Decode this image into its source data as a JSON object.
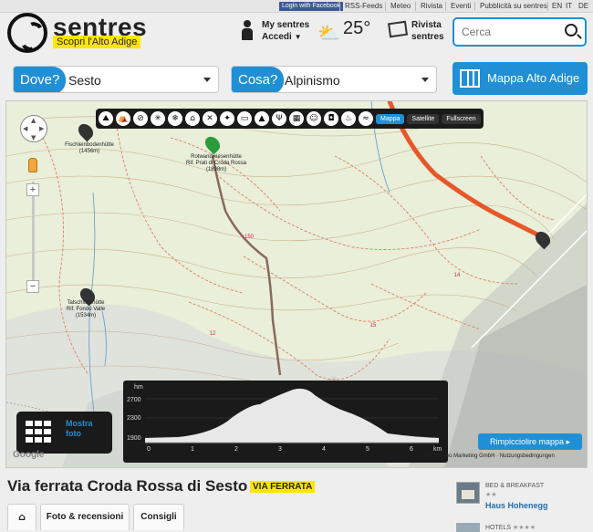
{
  "topbar": {
    "facebook_login": "Login with Facebook",
    "links": [
      "RSS-Feeds",
      "Meteo",
      "Rivista",
      "Eventi",
      "Pubblicità su sentres",
      "EN",
      "IT",
      "DE"
    ]
  },
  "brand": {
    "name": "sentres",
    "tagline": "Scopri l'Alto Adige"
  },
  "account": {
    "line1": "My sentres",
    "line2": "Accedi"
  },
  "weather": {
    "temperature": "25°"
  },
  "magazine": {
    "line1": "Rivista",
    "line2": "sentres"
  },
  "search": {
    "placeholder": "Cerca"
  },
  "filters": {
    "where": {
      "label": "Dove?",
      "value": "Sesto"
    },
    "what": {
      "label": "Cosa?",
      "value": "Alpinismo"
    }
  },
  "map_button": {
    "label": "Mappa Alto Adige"
  },
  "map": {
    "view_buttons": [
      "Mappa",
      "Satellite",
      "Fullscreen"
    ],
    "active_view": "Mappa",
    "category_icons": [
      "hiking-icon",
      "climbing-icon",
      "bike-icon",
      "ski-icon",
      "snow-icon",
      "hut-icon",
      "tool-icon",
      "food-icon",
      "bed-icon",
      "camping-icon",
      "fork-icon",
      "calendar-icon",
      "family-icon",
      "bag-icon",
      "spa-icon",
      "swim-icon"
    ],
    "huts": [
      {
        "name": "Fischleinbodenhütte",
        "elevation": "(1456m)"
      },
      {
        "name": "Rotwandwiesenhütte",
        "name2": "Rif. Prati di Croda Rossa",
        "elevation": "(1898m)"
      },
      {
        "name": "Talschlusshütte",
        "name2": "Rif. Fondo Valle",
        "elevation": "(1534m)"
      }
    ],
    "contour_labels": [
      "150",
      "15",
      "14",
      "12",
      "15",
      "14",
      "15",
      "14"
    ],
    "zoom_in": "+",
    "zoom_out": "−",
    "show_photos": "Mostra foto",
    "shrink_map": "Rimpicciolire mappa",
    "copyright": "© 2010 Geo Marketing GmbH ·",
    "terms": "Nutzungsbedingungen",
    "attribution": "Google"
  },
  "profile": {
    "unit_y": "hm",
    "unit_x": "km",
    "y_ticks": [
      "2700",
      "2300",
      "1900"
    ],
    "x_ticks": [
      "0",
      "1",
      "2",
      "3",
      "4",
      "5",
      "6"
    ]
  },
  "page": {
    "title": "Via ferrata Croda Rossa di Sesto",
    "badge": "VIA FERRATA",
    "tabs": [
      "Foto & recensioni",
      "Consigli"
    ]
  },
  "sidebar": {
    "item1": {
      "type": "BED & BREAKFAST",
      "stars": "★★",
      "name": "Haus Hohenegg"
    },
    "item2": {
      "type": "HOTELS",
      "stars": "★★★★"
    }
  },
  "colors": {
    "accent": "#1f8fd6",
    "highlight": "#ffe600",
    "route": "#e8572a"
  }
}
